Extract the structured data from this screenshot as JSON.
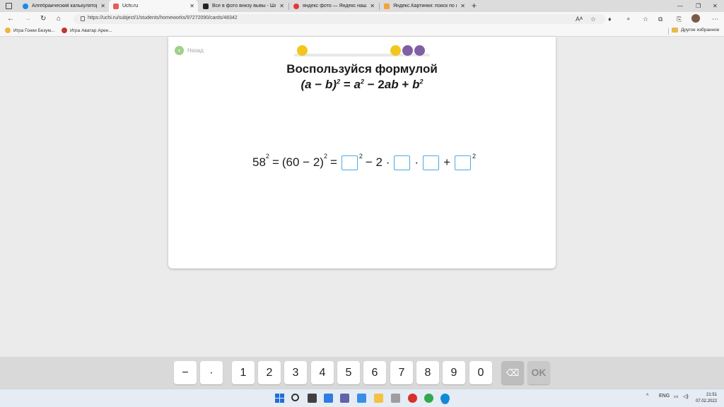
{
  "browser": {
    "tabs": [
      {
        "title": "Алгебраический калькулятор |",
        "color": "#1e88e5",
        "active": false
      },
      {
        "title": "Uchi.ru",
        "color": "#e55d5d",
        "active": true
      },
      {
        "title": "Все в фото внизу вывы - Школ",
        "color": "#222222",
        "active": false
      },
      {
        "title": "яндекс фото — Яндекс нашёл",
        "color": "#e53935",
        "active": false
      },
      {
        "title": "Яндекс.Картинки: поиск по изо",
        "color": "#f2a33a",
        "active": false
      }
    ],
    "url": "https://uchi.ru/subject/1/students/homeworks/97272090/cards/48342",
    "bookmarks": [
      {
        "label": "Игра Гонки Безум...",
        "color": "#f0b43c"
      },
      {
        "label": "Игра Аватар Арен...",
        "color": "#c0392b"
      }
    ],
    "other_bookmarks": "Другое избранное"
  },
  "page": {
    "back_label": "Назад",
    "title": "Воспользуйся формулой",
    "formula": {
      "a": "a",
      "minus": "−",
      "b": "b",
      "sq": "2",
      "eq": "=",
      "rhs1": "a",
      "minus2": "− 2",
      "ab": "ab",
      "plus": "+",
      "rhs3": "b"
    },
    "equation": {
      "base": "58",
      "exp": "2",
      "eq1": "=",
      "paren": "(60 − 2)",
      "eq2": "=",
      "minus_two": "− 2 ·",
      "dot": "·",
      "plus": "+"
    },
    "progress_colors": {
      "done": "#f2c71d",
      "current": "#7f5fa3"
    }
  },
  "keypad": {
    "keys": [
      "−",
      "·",
      "1",
      "2",
      "3",
      "4",
      "5",
      "6",
      "7",
      "8",
      "9",
      "0"
    ],
    "backspace": "⌫",
    "ok": "OK"
  },
  "taskbar": {
    "lang": "ENG",
    "time": "21:51",
    "date": "07.02.2022"
  }
}
